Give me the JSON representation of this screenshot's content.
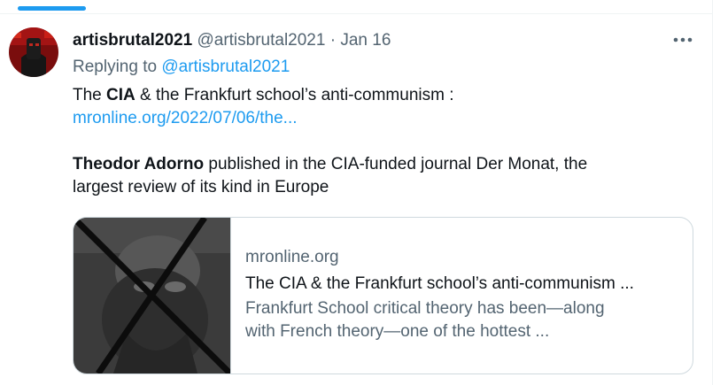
{
  "tweet": {
    "display_name": "artisbrutal2021",
    "handle": "@artisbrutal2021",
    "separator": "·",
    "date": "Jan 16",
    "replying_to_label": "Replying to",
    "replying_to_handle": "@artisbrutal2021",
    "line1_pre": "The ",
    "line1_bold": "CIA",
    "line1_post": " & the Frankfurt school’s anti-communism :",
    "link_text": "mronline.org/2022/07/06/the...",
    "para2_bold": "Theodor Adorno",
    "para2_line1": " published in the CIA-funded journal Der Monat, the",
    "para2_line2": "largest review of its kind in Europe",
    "more_icon": "more-horizontal-icon"
  },
  "card": {
    "domain": "mronline.org",
    "title": "The CIA & the Frankfurt school’s anti-communism ...",
    "desc_line1": "Frankfurt School critical theory has been—along",
    "desc_line2": "with French theory—one of the hottest ..."
  },
  "colors": {
    "accent": "#1d9bf0",
    "text_primary": "#0f1419",
    "text_secondary": "#536471",
    "border": "#cfd9de"
  }
}
